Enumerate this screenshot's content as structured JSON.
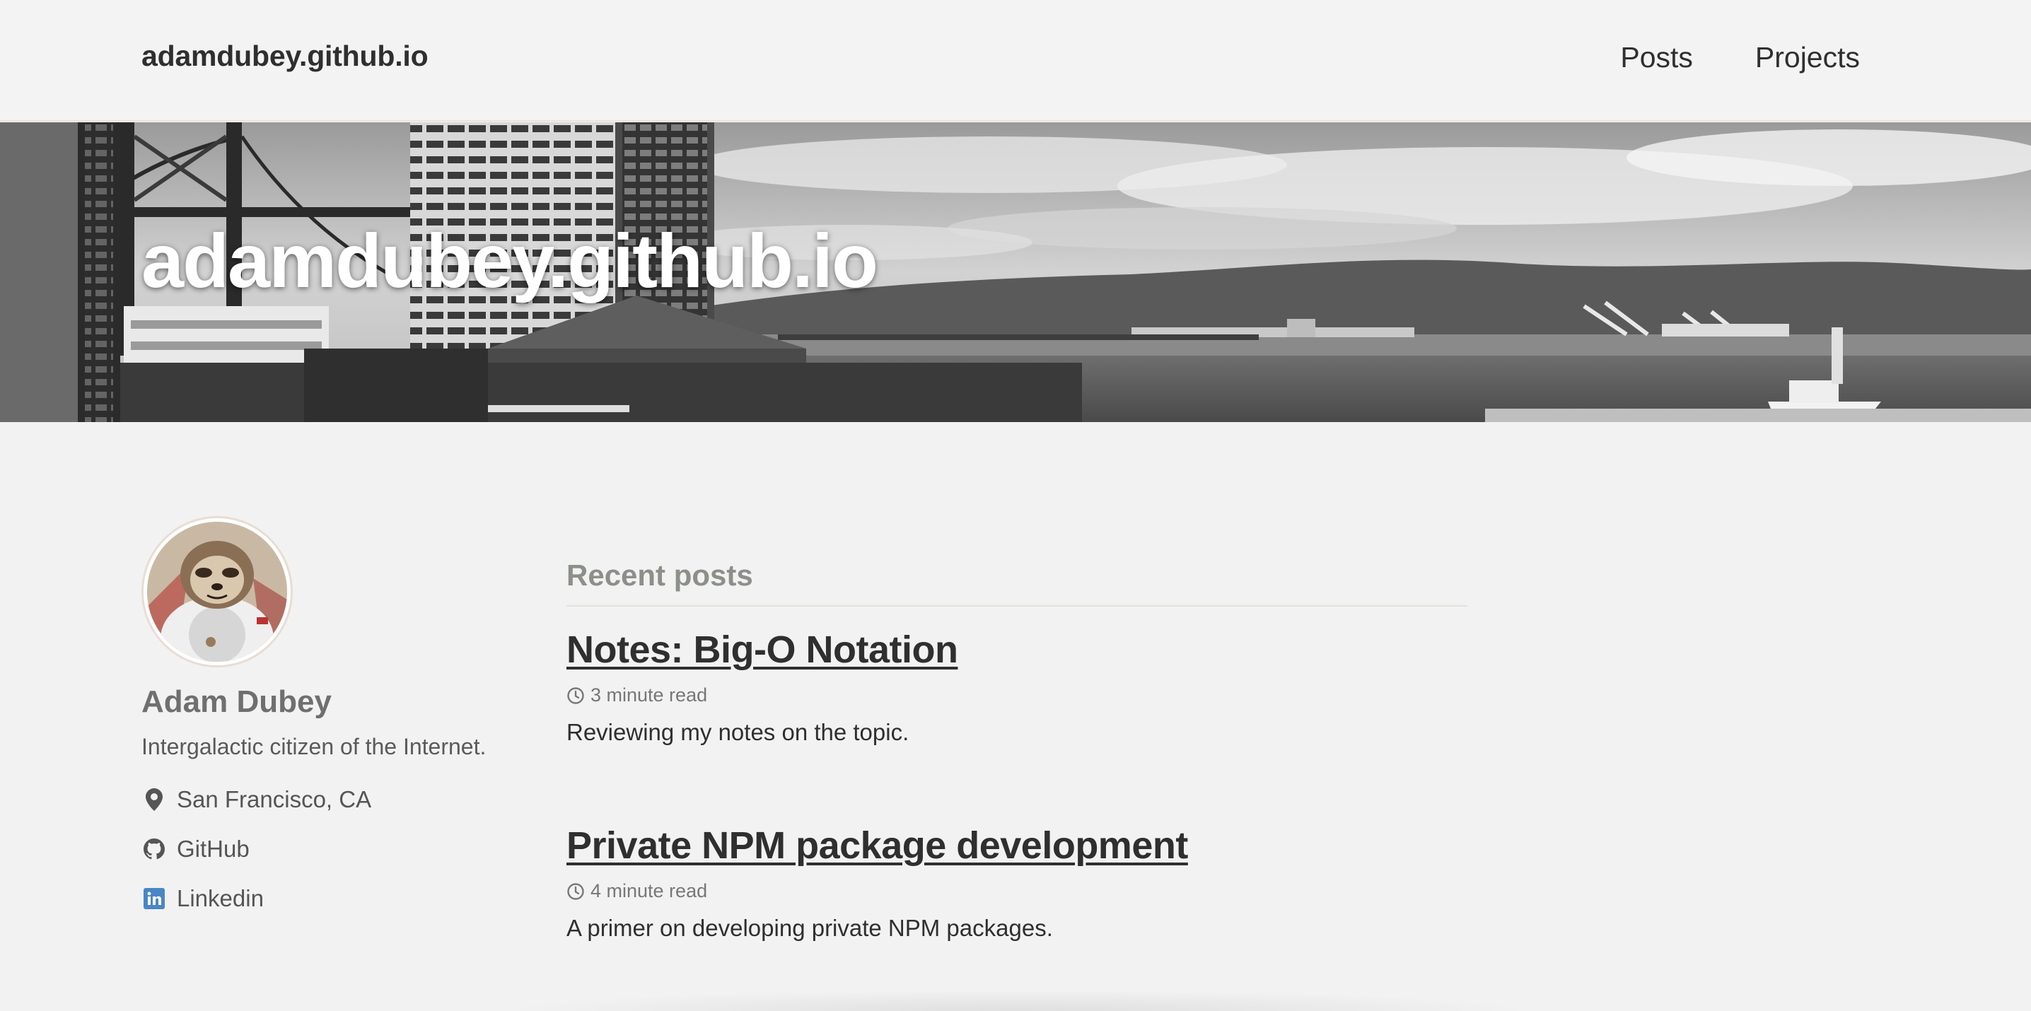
{
  "masthead": {
    "site_title": "adamdubey.github.io",
    "nav": [
      {
        "label": "Posts"
      },
      {
        "label": "Projects"
      }
    ]
  },
  "hero": {
    "title": "adamdubey.github.io"
  },
  "author": {
    "name": "Adam Dubey",
    "bio": "Intergalactic citizen of the Internet.",
    "links": [
      {
        "label": "San Francisco, CA",
        "icon": "map-marker-icon"
      },
      {
        "label": "GitHub",
        "icon": "github-icon"
      },
      {
        "label": "Linkedin",
        "icon": "linkedin-icon"
      }
    ]
  },
  "main": {
    "section_title": "Recent posts",
    "posts": [
      {
        "title": "Notes: Big-O Notation",
        "read_time": "3 minute read",
        "excerpt": "Reviewing my notes on the topic."
      },
      {
        "title": "Private NPM package development",
        "read_time": "4 minute read",
        "excerpt": "A primer on developing private NPM packages."
      }
    ]
  },
  "colors": {
    "background": "#f2f2f2",
    "text": "#2f2f2f",
    "muted": "#777777",
    "section_title": "#8c8f8a",
    "linkedin_blue": "#4a86c5"
  }
}
